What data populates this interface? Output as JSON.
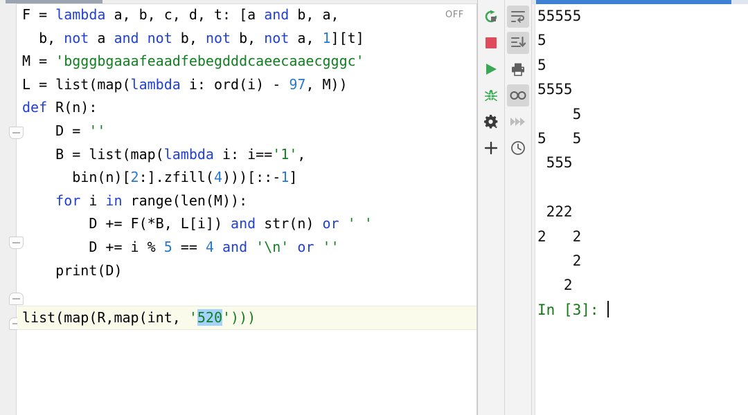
{
  "editor": {
    "scrollbar": {
      "name": "horizontal-scrollbar"
    },
    "off_badge": "OFF",
    "lines": [
      {
        "id": "line-1",
        "tokens": [
          {
            "t": "F = ",
            "c": "plain"
          },
          {
            "t": "lambda",
            "c": "kw"
          },
          {
            "t": " a, b, c, d, t: [a ",
            "c": "plain"
          },
          {
            "t": "and",
            "c": "kw"
          },
          {
            "t": " b, a,",
            "c": "plain"
          }
        ]
      },
      {
        "id": "line-2",
        "tokens": [
          {
            "t": "  b, ",
            "c": "plain"
          },
          {
            "t": "not",
            "c": "kw"
          },
          {
            "t": " a ",
            "c": "plain"
          },
          {
            "t": "and",
            "c": "kw"
          },
          {
            "t": " ",
            "c": "plain"
          },
          {
            "t": "not",
            "c": "kw"
          },
          {
            "t": " b, ",
            "c": "plain"
          },
          {
            "t": "not",
            "c": "kw"
          },
          {
            "t": " b, ",
            "c": "plain"
          },
          {
            "t": "not",
            "c": "kw"
          },
          {
            "t": " a, ",
            "c": "plain"
          },
          {
            "t": "1",
            "c": "num"
          },
          {
            "t": "][t]",
            "c": "plain"
          }
        ]
      },
      {
        "id": "line-3",
        "tokens": [
          {
            "t": "M = ",
            "c": "plain"
          },
          {
            "t": "'bgggbgaaafeaadfebegdddcaeecaaecgggc'",
            "c": "str"
          }
        ]
      },
      {
        "id": "line-4",
        "tokens": [
          {
            "t": "L = list(map(",
            "c": "plain"
          },
          {
            "t": "lambda",
            "c": "kw"
          },
          {
            "t": " i: ord(i) - ",
            "c": "plain"
          },
          {
            "t": "97",
            "c": "num"
          },
          {
            "t": ", M))",
            "c": "plain"
          }
        ]
      },
      {
        "id": "line-5",
        "tokens": [
          {
            "t": "def",
            "c": "kw"
          },
          {
            "t": " R(n):",
            "c": "plain"
          }
        ]
      },
      {
        "id": "line-6",
        "tokens": [
          {
            "t": "    D = ",
            "c": "plain"
          },
          {
            "t": "''",
            "c": "str"
          }
        ]
      },
      {
        "id": "line-7",
        "tokens": [
          {
            "t": "    B = list(map(",
            "c": "plain"
          },
          {
            "t": "lambda",
            "c": "kw"
          },
          {
            "t": " i: i==",
            "c": "plain"
          },
          {
            "t": "'1'",
            "c": "str"
          },
          {
            "t": ",",
            "c": "plain"
          }
        ]
      },
      {
        "id": "line-8",
        "tokens": [
          {
            "t": "      bin(n)[",
            "c": "plain"
          },
          {
            "t": "2",
            "c": "num"
          },
          {
            "t": ":].zfill(",
            "c": "plain"
          },
          {
            "t": "4",
            "c": "num"
          },
          {
            "t": ")))[::-",
            "c": "plain"
          },
          {
            "t": "1",
            "c": "num"
          },
          {
            "t": "]",
            "c": "plain"
          }
        ]
      },
      {
        "id": "line-9",
        "tokens": [
          {
            "t": "    ",
            "c": "plain"
          },
          {
            "t": "for",
            "c": "kw"
          },
          {
            "t": " i ",
            "c": "plain"
          },
          {
            "t": "in",
            "c": "kw"
          },
          {
            "t": " range(len(M)):",
            "c": "plain"
          }
        ]
      },
      {
        "id": "line-10",
        "tokens": [
          {
            "t": "        D += F(*B, L[i]) ",
            "c": "plain"
          },
          {
            "t": "and",
            "c": "kw"
          },
          {
            "t": " str(n) ",
            "c": "plain"
          },
          {
            "t": "or",
            "c": "kw"
          },
          {
            "t": " ",
            "c": "plain"
          },
          {
            "t": "' '",
            "c": "str"
          }
        ]
      },
      {
        "id": "line-11",
        "tokens": [
          {
            "t": "        D += i % ",
            "c": "plain"
          },
          {
            "t": "5",
            "c": "num"
          },
          {
            "t": " == ",
            "c": "plain"
          },
          {
            "t": "4",
            "c": "num"
          },
          {
            "t": " ",
            "c": "plain"
          },
          {
            "t": "and",
            "c": "kw"
          },
          {
            "t": " ",
            "c": "plain"
          },
          {
            "t": "'\\n'",
            "c": "str"
          },
          {
            "t": " ",
            "c": "plain"
          },
          {
            "t": "or",
            "c": "kw"
          },
          {
            "t": " ",
            "c": "plain"
          },
          {
            "t": "''",
            "c": "str"
          }
        ]
      },
      {
        "id": "line-12",
        "tokens": [
          {
            "t": "    print(D)",
            "c": "plain"
          }
        ]
      },
      {
        "id": "line-13",
        "tokens": []
      },
      {
        "id": "line-14",
        "highlight": true,
        "tokens": [
          {
            "t": "list(map(R,map(int, ",
            "c": "plain"
          },
          {
            "t": "'",
            "c": "str"
          },
          {
            "t": "520",
            "c": "str sel"
          },
          {
            "t": "')))",
            "c": "str"
          }
        ]
      }
    ]
  },
  "toolbar_left": {
    "name": "run-toolbar",
    "buttons": [
      {
        "name": "restart-kernel-icon",
        "label": "Restart kernel"
      },
      {
        "name": "stop-icon",
        "label": "Stop"
      },
      {
        "name": "run-icon",
        "label": "Run"
      },
      {
        "name": "debug-bug-icon",
        "label": "Debug"
      },
      {
        "name": "options-gear-icon",
        "label": "Options"
      },
      {
        "name": "add-plus-icon",
        "label": "New"
      }
    ]
  },
  "toolbar_right": {
    "name": "console-toolbar",
    "buttons": [
      {
        "name": "wrap-lines-icon",
        "label": "Wrap lines",
        "boxed": true
      },
      {
        "name": "sort-descending-icon",
        "label": "Sort",
        "boxed": true
      },
      {
        "name": "printer-icon",
        "label": "Print",
        "boxed": false
      },
      {
        "name": "glasses-inspect-icon",
        "label": "Inspect",
        "boxed": true
      },
      {
        "name": "fast-forward-icon",
        "label": "Step forward",
        "boxed": false
      },
      {
        "name": "history-clock-icon",
        "label": "History",
        "boxed": false
      }
    ]
  },
  "console": {
    "name": "ipython-console",
    "output_lines": [
      "55555",
      "5",
      "5",
      "5555",
      "    5",
      "5   5",
      " 555",
      "",
      " 222",
      "2   2",
      "    2",
      "   2"
    ],
    "prompt_label": "In [3]: ",
    "prompt_value": "",
    "scrollbar": {
      "name": "console-scrollbar"
    }
  },
  "colors": {
    "keyword": "#2040d8",
    "string": "#108020",
    "number": "#2878d0",
    "selection": "#a6d2ff",
    "prompt_green": "#127a12",
    "accent_blue": "#3d7fd1",
    "run_green": "#3aa853",
    "stop_red": "#e04a5a"
  }
}
